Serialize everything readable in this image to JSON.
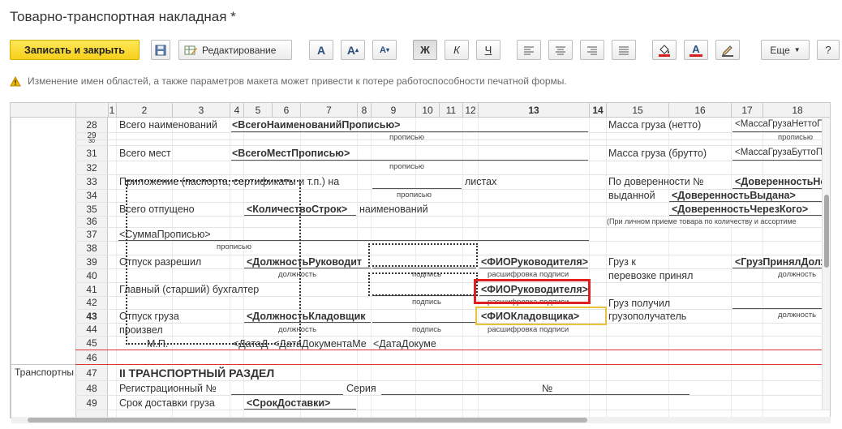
{
  "window": {
    "title": "Товарно-транспортная накладная *"
  },
  "toolbar": {
    "save_close_label": "Записать и закрыть",
    "save_icon": "floppy-disk-icon",
    "edit_label": "Редактирование",
    "font_a_label": "A",
    "font_grow_label": "A",
    "font_shrink_label": "A",
    "bold_label": "Ж",
    "italic_label": "К",
    "underline_label": "Ч",
    "text_color_label": "A",
    "more_label": "Еще",
    "help_label": "?"
  },
  "warning": {
    "text": "Изменение имен областей, а также параметров макета может привести к потере работоспособности печатной формы."
  },
  "columns": [
    "1",
    "2",
    "3",
    "4",
    "5",
    "6",
    "7",
    "8",
    "9",
    "10",
    "11",
    "12",
    "13",
    "14",
    "15",
    "16",
    "17",
    "18"
  ],
  "rows": [
    "28",
    "29",
    "30",
    "31",
    "32",
    "33",
    "34",
    "35",
    "36",
    "37",
    "38",
    "39",
    "40",
    "41",
    "42",
    "43",
    "44",
    "45",
    "46",
    "47",
    "48",
    "49"
  ],
  "area_labels": {
    "transport": "Транспортны"
  },
  "cells": {
    "r28_label": "Всего наименований",
    "r28_param": "<ВсегоНаименованийПрописью>",
    "r28_mass": "Масса груза (нетто)",
    "r28_mass_param": "<МассаГрузаНеттоП",
    "r29_hint": "прописью",
    "r29_hint2": "прописью",
    "r31_label": "Всего мест",
    "r31_param": "<ВсегоМестПрописью>",
    "r31_mass": "Масса груза (брутто)",
    "r31_mass_param": "<МассаГрузаБуттоПр",
    "r32_hint": "прописью",
    "r33_label": "Приложение (паспорта, сертификаты и т.п.) на",
    "r33_sheets": "листах",
    "r33_proxy": "По доверенности №",
    "r33_proxy_param": "<ДоверенностьНо",
    "r34_hint": "прописью",
    "r34_issued": "выданной",
    "r34_issued_param": "<ДоверенностьВыдана>",
    "r35_label": "Всего отпущено",
    "r35_param": "<КоличествоСтрок>",
    "r35_items": "наименований",
    "r35_via_param": "<ДоверенностьЧерезКого>",
    "r36_note": "(При личном приеме товара по количеству и ассортиме",
    "r37_param": "<СуммаПрописью>",
    "r38_hint": "прописью",
    "r39_label": "Отпуск разрешил",
    "r39_param": "<ДолжностьРуководит",
    "r39_fio": "<ФИОРуководителя>",
    "r39_cargo": "Груз к",
    "r39_cargo_param": "<ГрузПринялДолж",
    "r40_pos": "должность",
    "r40_sign": "подпись",
    "r40_decode": "расшифровка подписи",
    "r40_accepted": "перевозке принял",
    "r40_pos2": "должность",
    "r41_label": "Главный (старший) бухгалтер",
    "r41_fio": "<ФИОРуководителя>",
    "r42_sign": "подпись",
    "r42_decode": "расшифровка подписи",
    "r42_received": "Груз получил",
    "r43_label": "Отпуск груза",
    "r43_param": "<ДолжностьКладовщик",
    "r43_fio": "<ФИОКладовщика>",
    "r43_consignee": "грузополучатель",
    "r43_pos": "должность",
    "r44_label": "произвел",
    "r44_pos": "должность",
    "r44_sign": "подпись",
    "r44_decode": "расшифровка подписи",
    "r45_mp": "М.П.",
    "r45_date1": "<ДатаД",
    "r45_date2": "<ДатаДокументаМе",
    "r45_date3": "<ДатаДокуме",
    "r47_section": "II ТРАНСПОРТНЫЙ РАЗДЕЛ",
    "r48_reg": "Регистрационный №",
    "r48_series": "Серия",
    "r48_num": "№",
    "r49_delivery": "Срок доставки груза",
    "r49_param": "<СрокДоставки>"
  },
  "colors": {
    "primary": "#f5cf1a",
    "selection_red": "#e02020",
    "selection_yellow": "#e8c23a",
    "area_line": "#d33"
  }
}
